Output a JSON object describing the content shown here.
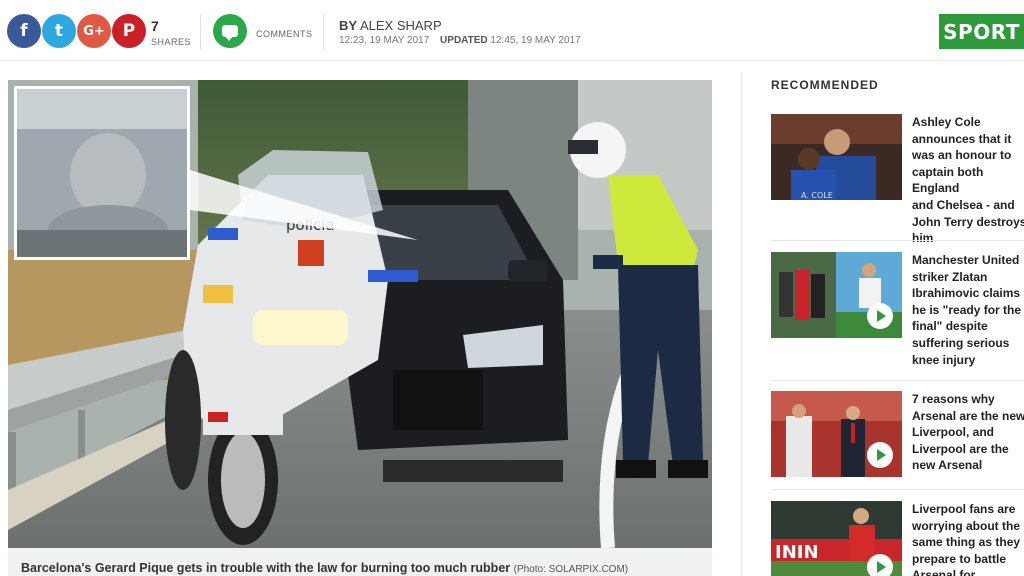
{
  "share_bar": {
    "icons": [
      "facebook-icon",
      "twitter-icon",
      "google-plus-icon",
      "pinterest-icon"
    ],
    "google_plus_glyph": "G+",
    "pinterest_glyph": "P",
    "facebook_glyph": "f",
    "twitter_glyph": "t",
    "count": "7",
    "count_label": "SHARES"
  },
  "comments": {
    "label": "COMMENTS"
  },
  "byline": {
    "prefix": "BY",
    "author": "ALEX SHARP",
    "published": "12:23, 19 MAY 2017",
    "updated_label": "UPDATED",
    "updated": "12:45, 19 MAY 2017"
  },
  "section_button": {
    "label": "SPORT",
    "color": "#2e9a3c"
  },
  "main_image": {
    "caption": "Barcelona's Gerard Pique gets in trouble with the law for burning too much rubber",
    "credit": "(Photo: SOLARPIX.COM)",
    "bike_text": "policia"
  },
  "recommended": {
    "heading": "RECOMMENDED",
    "items": [
      {
        "text": "Ashley Cole\nannounces that it\nwas an honour to\ncaptain both England\nand Chelsea - and\nJohn Terry destroys\nhim",
        "shirt_text": "A. COLE",
        "has_video": false
      },
      {
        "text": "Manchester United\nstriker Zlatan\nIbrahimovic claims\nhe is \"ready for the\nfinal\" despite\nsuffering serious\nknee injury",
        "has_video": true
      },
      {
        "text": "7 reasons why\nArsenal are the new\nLiverpool, and\nLiverpool are the\nnew Arsenal",
        "has_video": true
      },
      {
        "text": "Liverpool fans are\nworrying about the\nsame thing as they\nprepare to battle\nArsenal for",
        "board_text": "ININ",
        "has_video": true
      }
    ]
  }
}
